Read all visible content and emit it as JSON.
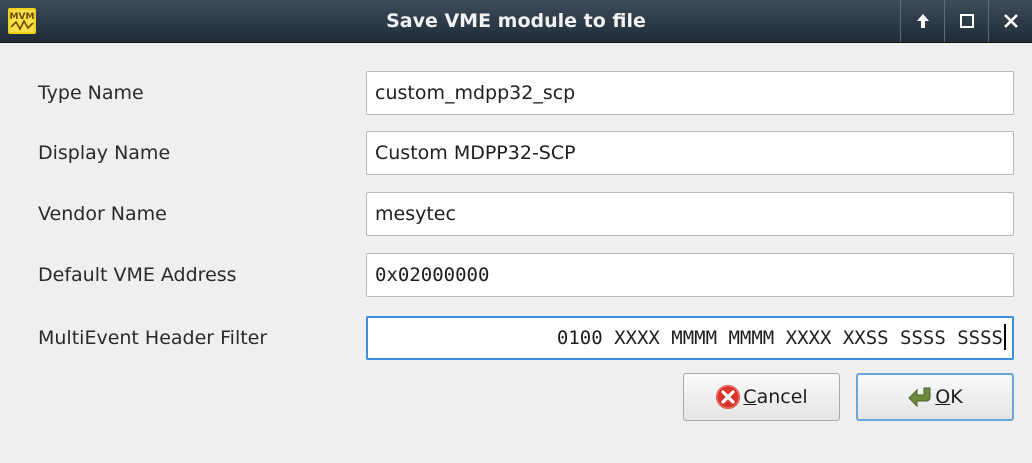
{
  "window": {
    "title": "Save VME module to file",
    "icon": "mvme-app-icon",
    "controls": [
      "keep-above",
      "maximize",
      "close"
    ]
  },
  "form": {
    "rows": [
      {
        "label": "Type Name",
        "value": "custom_mdpp32_scp"
      },
      {
        "label": "Display Name",
        "value": "Custom MDPP32-SCP"
      },
      {
        "label": "Vendor Name",
        "value": "mesytec"
      },
      {
        "label": "Default VME Address",
        "value": "0x02000000"
      },
      {
        "label": "MultiEvent Header Filter",
        "value": "0100 XXXX MMMM MMMM XXXX XXSS SSSS SSSS"
      }
    ]
  },
  "buttons": {
    "cancel_label": "Cancel",
    "ok_label": "OK"
  },
  "colors": {
    "titlebar": "#2b3744",
    "focus_border": "#3a8fd6",
    "cancel_icon": "#d9342b",
    "ok_icon": "#6e8b3d"
  }
}
